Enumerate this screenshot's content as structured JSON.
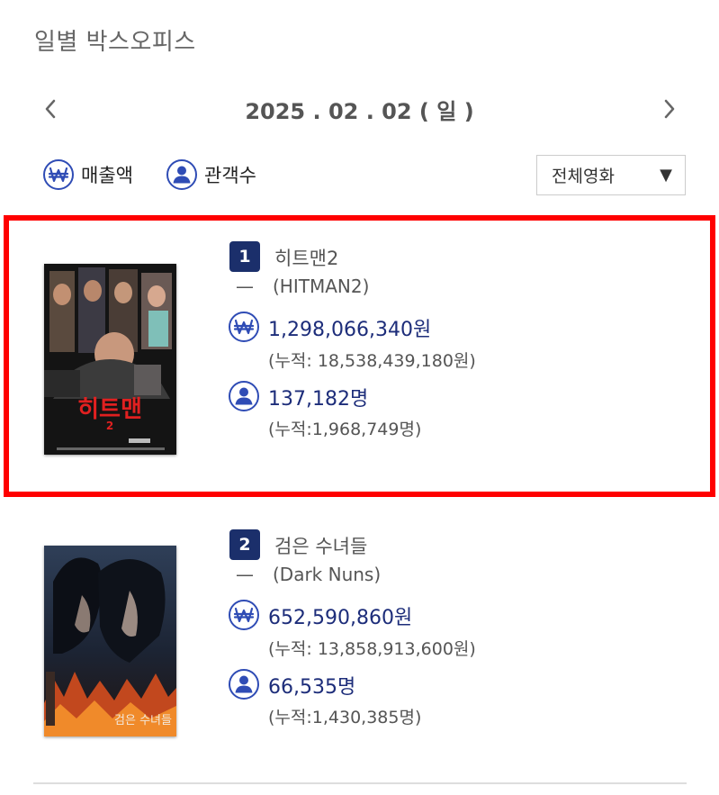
{
  "header": {
    "title": "일별 박스오피스"
  },
  "date_nav": {
    "date": "2025 . 02 . 02 ( 일 )"
  },
  "toggles": {
    "sales_label": "매출액",
    "audience_label": "관객수"
  },
  "filter": {
    "selected": "전체영화",
    "caret": "▼"
  },
  "colors": {
    "accent": "#1b2f6b",
    "icon_blue": "#2f4cb5",
    "value_blue": "#1d2d7a",
    "highlight": "#ff0000"
  },
  "movies": [
    {
      "rank": "1",
      "title": "히트맨2",
      "rank_change": "—",
      "original_title": "(HITMAN2)",
      "sales": "1,298,066,340원",
      "sales_cumulative": "(누적: 18,538,439,180원)",
      "audience": "137,182명",
      "audience_cumulative": "(누적:1,968,749명)",
      "poster_title": "히트맨",
      "poster_num": "2"
    },
    {
      "rank": "2",
      "title": "검은 수녀들",
      "rank_change": "—",
      "original_title": "(Dark Nuns)",
      "sales": "652,590,860원",
      "sales_cumulative": "(누적: 13,858,913,600원)",
      "audience": "66,535명",
      "audience_cumulative": "(누적:1,430,385명)",
      "poster_title": "검은 수녀들"
    }
  ]
}
